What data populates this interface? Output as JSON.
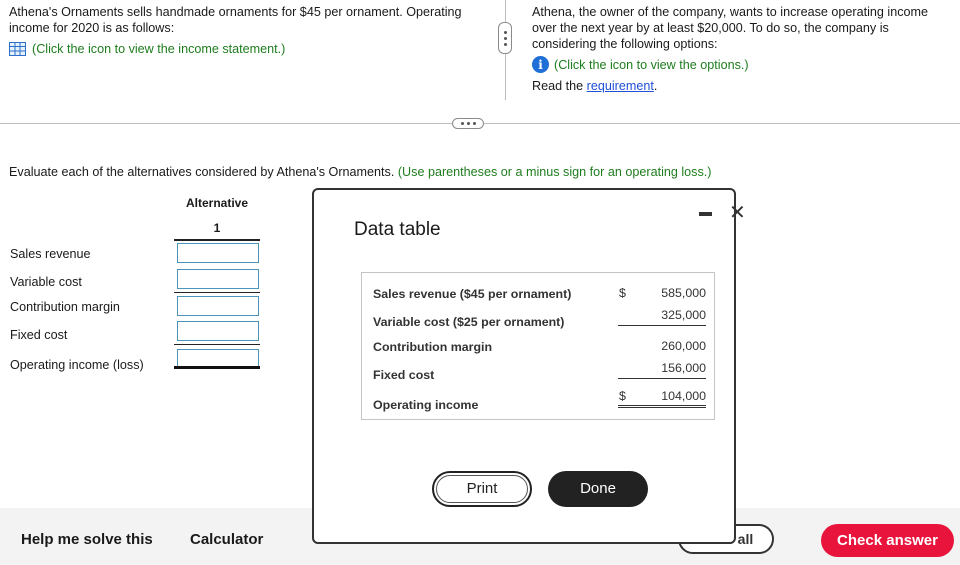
{
  "left_panel": {
    "text": "Athena's Ornaments sells handmade ornaments for $45 per ornament. Operating income for 2020 is as follows:",
    "link": "(Click the icon to view the income statement.)",
    "icon": "table-icon"
  },
  "right_panel": {
    "text": "Athena, the owner of the company, wants to increase operating income over the next year by at least $20,000. To do so, the company is considering the following options:",
    "link": "(Click the icon to view the options.)",
    "icon": "info-icon",
    "read_prefix": "Read the ",
    "read_link": "requirement",
    "read_suffix": "."
  },
  "instruction": {
    "text": "Evaluate each of the alternatives considered by Athena's Ornaments. ",
    "hint": "(Use parentheses or a minus sign for an operating loss.)"
  },
  "worksheet": {
    "header": "Alternative",
    "column": "1",
    "rows": [
      {
        "label": "Sales revenue",
        "value": ""
      },
      {
        "label": "Variable cost",
        "value": ""
      },
      {
        "label": "Contribution margin",
        "value": ""
      },
      {
        "label": "Fixed cost",
        "value": ""
      },
      {
        "label": "Operating income (loss)",
        "value": ""
      }
    ]
  },
  "modal": {
    "title": "Data table",
    "rows": [
      {
        "label": "Sales revenue ($45 per ornament)",
        "dollar": "$",
        "value": "585,000"
      },
      {
        "label": "Variable cost ($25 per ornament)",
        "dollar": "",
        "value": "325,000"
      },
      {
        "label": "Contribution margin",
        "dollar": "",
        "value": "260,000"
      },
      {
        "label": "Fixed cost",
        "dollar": "",
        "value": "156,000"
      },
      {
        "label": "Operating income",
        "dollar": "$",
        "value": "104,000"
      }
    ],
    "print_label": "Print",
    "done_label": "Done"
  },
  "footer": {
    "help_label": "Help me solve this",
    "calculator_label": "Calculator",
    "clear_label": "Clear all",
    "check_label": "Check answer"
  },
  "colors": {
    "accent_green": "#1e7d1e",
    "link_blue": "#1f4fd6",
    "check_red": "#e8143c",
    "input_border": "#4c95b8"
  }
}
